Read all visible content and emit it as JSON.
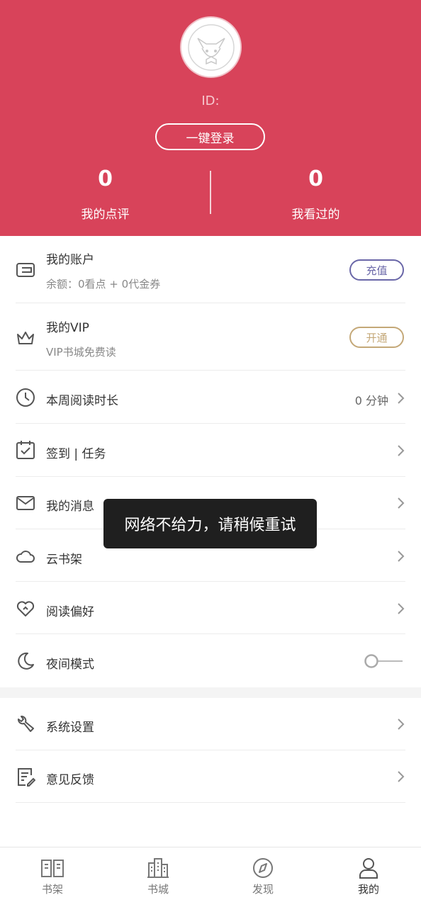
{
  "header": {
    "id_label": "ID:",
    "login_button": "一键登录",
    "stats": [
      {
        "value": "0",
        "label": "我的点评"
      },
      {
        "value": "0",
        "label": "我看过的"
      }
    ],
    "background_color": "#d8435a"
  },
  "menu": {
    "account": {
      "title": "我的账户",
      "subtitle": "余额：0看点 + 0代金券",
      "action": "充值",
      "action_color": "#6a67a8"
    },
    "vip": {
      "title": "我的VIP",
      "subtitle": "VIP书城免费读",
      "action": "开通",
      "action_color": "#c4a878"
    },
    "reading_time": {
      "title": "本周阅读时长",
      "value": "0 分钟"
    },
    "checkin": {
      "title": "签到 | 任务"
    },
    "messages": {
      "title": "我的消息"
    },
    "cloud_shelf": {
      "title": "云书架"
    },
    "preference": {
      "title": "阅读偏好"
    },
    "night_mode": {
      "title": "夜间模式",
      "enabled": false
    }
  },
  "menu2": {
    "settings": {
      "title": "系统设置"
    },
    "feedback": {
      "title": "意见反馈"
    }
  },
  "toast": {
    "text": "网络不给力，请稍候重试"
  },
  "tabbar": {
    "tabs": [
      {
        "label": "书架",
        "icon": "bookshelf-icon"
      },
      {
        "label": "书城",
        "icon": "bookstore-icon"
      },
      {
        "label": "发现",
        "icon": "compass-icon"
      },
      {
        "label": "我的",
        "icon": "user-icon"
      }
    ],
    "active_index": 3
  }
}
